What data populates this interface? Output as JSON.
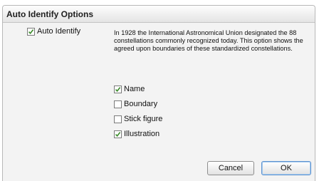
{
  "dialog": {
    "title": "Auto Identify Options",
    "auto_identify": {
      "label": "Auto Identify",
      "checked": true
    },
    "description": "In 1928 the International Astronomical Union designated the 88 constellations commonly recognized today. This option shows the agreed upon boundaries of these standardized constellations.",
    "options": [
      {
        "label": "Name",
        "checked": true
      },
      {
        "label": "Boundary",
        "checked": false
      },
      {
        "label": "Stick figure",
        "checked": false
      },
      {
        "label": "Illustration",
        "checked": true
      }
    ],
    "buttons": {
      "cancel": "Cancel",
      "ok": "OK"
    }
  },
  "colors": {
    "check": "#3a8a2a",
    "ok_border": "#5e92cf"
  },
  "icons": {
    "checkmark": "checkmark-icon"
  }
}
